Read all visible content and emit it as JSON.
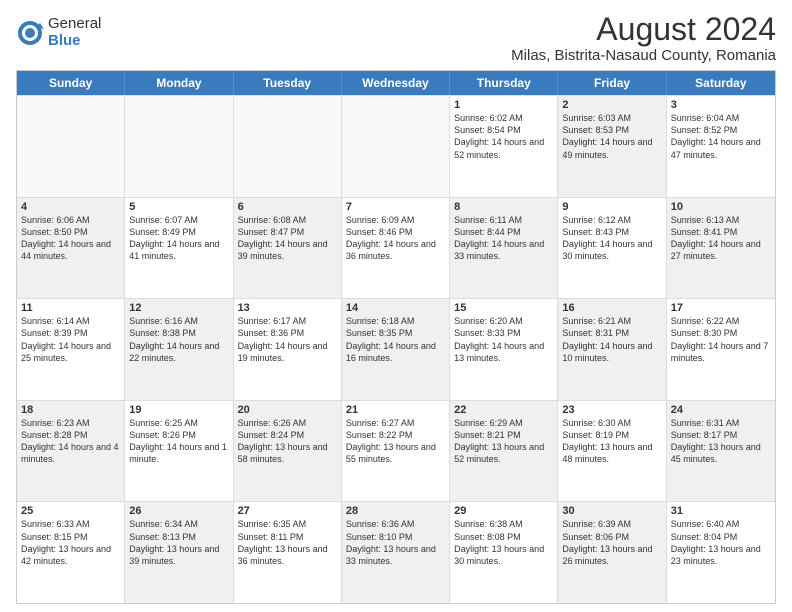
{
  "logo": {
    "general": "General",
    "blue": "Blue"
  },
  "title": "August 2024",
  "subtitle": "Milas, Bistrita-Nasaud County, Romania",
  "headers": [
    "Sunday",
    "Monday",
    "Tuesday",
    "Wednesday",
    "Thursday",
    "Friday",
    "Saturday"
  ],
  "rows": [
    [
      {
        "day": "",
        "text": "",
        "empty": true
      },
      {
        "day": "",
        "text": "",
        "empty": true
      },
      {
        "day": "",
        "text": "",
        "empty": true
      },
      {
        "day": "",
        "text": "",
        "empty": true
      },
      {
        "day": "1",
        "text": "Sunrise: 6:02 AM\nSunset: 8:54 PM\nDaylight: 14 hours and 52 minutes."
      },
      {
        "day": "2",
        "text": "Sunrise: 6:03 AM\nSunset: 8:53 PM\nDaylight: 14 hours and 49 minutes.",
        "shaded": true
      },
      {
        "day": "3",
        "text": "Sunrise: 6:04 AM\nSunset: 8:52 PM\nDaylight: 14 hours and 47 minutes."
      }
    ],
    [
      {
        "day": "4",
        "text": "Sunrise: 6:06 AM\nSunset: 8:50 PM\nDaylight: 14 hours and 44 minutes.",
        "shaded": true
      },
      {
        "day": "5",
        "text": "Sunrise: 6:07 AM\nSunset: 8:49 PM\nDaylight: 14 hours and 41 minutes."
      },
      {
        "day": "6",
        "text": "Sunrise: 6:08 AM\nSunset: 8:47 PM\nDaylight: 14 hours and 39 minutes.",
        "shaded": true
      },
      {
        "day": "7",
        "text": "Sunrise: 6:09 AM\nSunset: 8:46 PM\nDaylight: 14 hours and 36 minutes."
      },
      {
        "day": "8",
        "text": "Sunrise: 6:11 AM\nSunset: 8:44 PM\nDaylight: 14 hours and 33 minutes.",
        "shaded": true
      },
      {
        "day": "9",
        "text": "Sunrise: 6:12 AM\nSunset: 8:43 PM\nDaylight: 14 hours and 30 minutes."
      },
      {
        "day": "10",
        "text": "Sunrise: 6:13 AM\nSunset: 8:41 PM\nDaylight: 14 hours and 27 minutes.",
        "shaded": true
      }
    ],
    [
      {
        "day": "11",
        "text": "Sunrise: 6:14 AM\nSunset: 8:39 PM\nDaylight: 14 hours and 25 minutes."
      },
      {
        "day": "12",
        "text": "Sunrise: 6:16 AM\nSunset: 8:38 PM\nDaylight: 14 hours and 22 minutes.",
        "shaded": true
      },
      {
        "day": "13",
        "text": "Sunrise: 6:17 AM\nSunset: 8:36 PM\nDaylight: 14 hours and 19 minutes."
      },
      {
        "day": "14",
        "text": "Sunrise: 6:18 AM\nSunset: 8:35 PM\nDaylight: 14 hours and 16 minutes.",
        "shaded": true
      },
      {
        "day": "15",
        "text": "Sunrise: 6:20 AM\nSunset: 8:33 PM\nDaylight: 14 hours and 13 minutes."
      },
      {
        "day": "16",
        "text": "Sunrise: 6:21 AM\nSunset: 8:31 PM\nDaylight: 14 hours and 10 minutes.",
        "shaded": true
      },
      {
        "day": "17",
        "text": "Sunrise: 6:22 AM\nSunset: 8:30 PM\nDaylight: 14 hours and 7 minutes."
      }
    ],
    [
      {
        "day": "18",
        "text": "Sunrise: 6:23 AM\nSunset: 8:28 PM\nDaylight: 14 hours and 4 minutes.",
        "shaded": true
      },
      {
        "day": "19",
        "text": "Sunrise: 6:25 AM\nSunset: 8:26 PM\nDaylight: 14 hours and 1 minute."
      },
      {
        "day": "20",
        "text": "Sunrise: 6:26 AM\nSunset: 8:24 PM\nDaylight: 13 hours and 58 minutes.",
        "shaded": true
      },
      {
        "day": "21",
        "text": "Sunrise: 6:27 AM\nSunset: 8:22 PM\nDaylight: 13 hours and 55 minutes."
      },
      {
        "day": "22",
        "text": "Sunrise: 6:29 AM\nSunset: 8:21 PM\nDaylight: 13 hours and 52 minutes.",
        "shaded": true
      },
      {
        "day": "23",
        "text": "Sunrise: 6:30 AM\nSunset: 8:19 PM\nDaylight: 13 hours and 48 minutes."
      },
      {
        "day": "24",
        "text": "Sunrise: 6:31 AM\nSunset: 8:17 PM\nDaylight: 13 hours and 45 minutes.",
        "shaded": true
      }
    ],
    [
      {
        "day": "25",
        "text": "Sunrise: 6:33 AM\nSunset: 8:15 PM\nDaylight: 13 hours and 42 minutes."
      },
      {
        "day": "26",
        "text": "Sunrise: 6:34 AM\nSunset: 8:13 PM\nDaylight: 13 hours and 39 minutes.",
        "shaded": true
      },
      {
        "day": "27",
        "text": "Sunrise: 6:35 AM\nSunset: 8:11 PM\nDaylight: 13 hours and 36 minutes."
      },
      {
        "day": "28",
        "text": "Sunrise: 6:36 AM\nSunset: 8:10 PM\nDaylight: 13 hours and 33 minutes.",
        "shaded": true
      },
      {
        "day": "29",
        "text": "Sunrise: 6:38 AM\nSunset: 8:08 PM\nDaylight: 13 hours and 30 minutes."
      },
      {
        "day": "30",
        "text": "Sunrise: 6:39 AM\nSunset: 8:06 PM\nDaylight: 13 hours and 26 minutes.",
        "shaded": true
      },
      {
        "day": "31",
        "text": "Sunrise: 6:40 AM\nSunset: 8:04 PM\nDaylight: 13 hours and 23 minutes."
      }
    ]
  ]
}
